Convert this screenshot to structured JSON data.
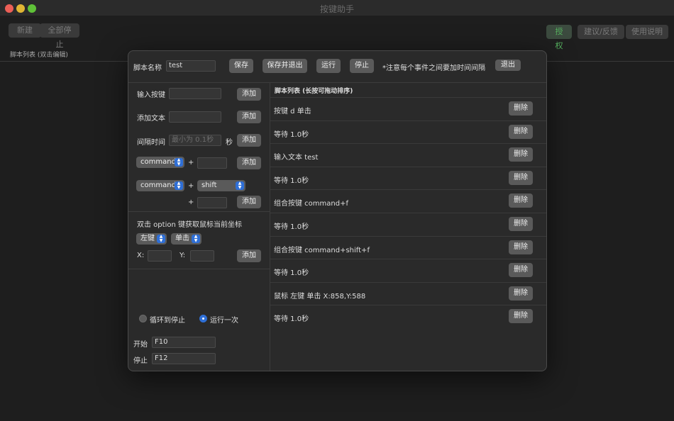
{
  "window": {
    "title": "按键助手"
  },
  "toolbar": {
    "new_label": "新建",
    "stop_all_label": "全部停止",
    "auth_label": "授权",
    "feedback_label": "建议/反馈",
    "help_label": "使用说明"
  },
  "script_list_label": "脚本列表 (双击编辑)",
  "editor": {
    "name_label": "脚本名称",
    "name_value": "test",
    "save_label": "保存",
    "save_exit_label": "保存并退出",
    "run_label": "运行",
    "stop_label": "停止",
    "notice": "*注意每个事件之间要加时间间隔",
    "exit_label": "退出",
    "input_key_label": "输入按键",
    "add_text_label": "添加文本",
    "interval_label": "间隔时间",
    "interval_placeholder": "最小为 0.1秒",
    "interval_unit": "秒",
    "add_label": "添加",
    "combo1_modifier": "command",
    "combo2_modifier": "command",
    "combo2_modifier2": "shift",
    "plus": "+",
    "mouse_hint": "双击 option 键获取鼠标当前坐标",
    "mouse_button": "左键",
    "click_type": "单击",
    "x_label": "X:",
    "y_label": "Y:",
    "loop_label": "循环到停止",
    "once_label": "运行一次",
    "start_label": "开始",
    "start_hotkey": "F10",
    "stop_hotkey_label": "停止",
    "stop_hotkey": "F12"
  },
  "events": {
    "header": "脚本列表 (长按可拖动排序)",
    "delete_label": "删除",
    "items": [
      "按键 d 单击",
      "等待 1.0秒",
      "输入文本 test",
      "等待 1.0秒",
      "组合按键 command+f",
      "等待 1.0秒",
      "组合按键 command+shift+f",
      "等待 1.0秒",
      "鼠标 左键 单击 X:858,Y:588",
      "等待 1.0秒"
    ]
  }
}
